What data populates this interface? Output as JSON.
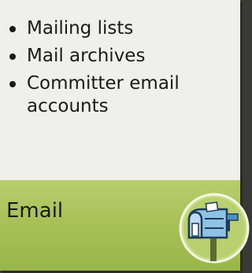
{
  "card": {
    "items": [
      {
        "label": "Mailing lists"
      },
      {
        "label": "Mail archives"
      },
      {
        "label": "Committer email accounts"
      }
    ],
    "title": "Email"
  },
  "colors": {
    "panel": "#efefec",
    "band": "#a5c054",
    "background": "#3a3a35"
  },
  "icon": {
    "name": "mailbox-icon"
  }
}
